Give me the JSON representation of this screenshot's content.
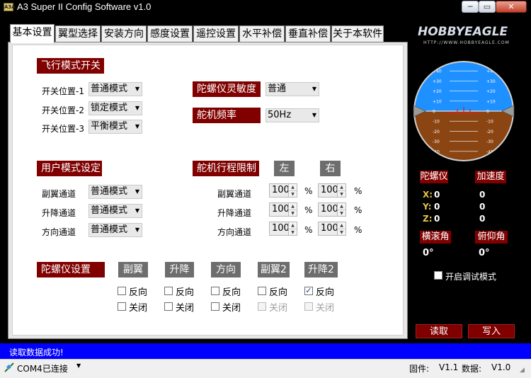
{
  "window": {
    "icon_text": "A3A",
    "title": "A3 Super II Config Software v1.0",
    "min_glyph": "─",
    "max_glyph": "▭",
    "close_glyph": "✕"
  },
  "tabs": [
    {
      "label": "基本设置",
      "active": true
    },
    {
      "label": "翼型选择"
    },
    {
      "label": "安装方向"
    },
    {
      "label": "感度设置"
    },
    {
      "label": "遥控设置"
    },
    {
      "label": "水平补偿"
    },
    {
      "label": "垂直补偿"
    },
    {
      "label": "关于本软件"
    }
  ],
  "flight_mode": {
    "title": "飞行模式开关",
    "rows": [
      {
        "label": "开关位置-1",
        "value": "普通模式"
      },
      {
        "label": "开关位置-2",
        "value": "锁定模式"
      },
      {
        "label": "开关位置-3",
        "value": "平衡模式"
      }
    ]
  },
  "gyro_sensitivity": {
    "title": "陀螺仪灵敏度",
    "value": "普通"
  },
  "servo_freq": {
    "title": "舵机频率",
    "value": "50Hz"
  },
  "user_mode": {
    "title": "用户模式设定",
    "rows": [
      {
        "label": "副翼通道",
        "value": "普通模式"
      },
      {
        "label": "升降通道",
        "value": "普通模式"
      },
      {
        "label": "方向通道",
        "value": "普通模式"
      }
    ]
  },
  "servo_travel": {
    "title": "舵机行程限制",
    "left_label": "左",
    "right_label": "右",
    "unit": "%",
    "rows": [
      {
        "label": "副翼通道",
        "left": "100",
        "right": "100"
      },
      {
        "label": "升降通道",
        "left": "100",
        "right": "100"
      },
      {
        "label": "方向通道",
        "left": "100",
        "right": "100"
      }
    ]
  },
  "gyro_settings": {
    "title": "陀螺仪设置",
    "reverse_label": "反向",
    "close_label": "关闭",
    "channels": [
      {
        "label": "副翼",
        "reverse": false,
        "close": false,
        "close_disabled": false
      },
      {
        "label": "升降",
        "reverse": false,
        "close": false,
        "close_disabled": false
      },
      {
        "label": "方向",
        "reverse": false,
        "close": false,
        "close_disabled": false
      },
      {
        "label": "副翼2",
        "reverse": false,
        "close": false,
        "close_disabled": true
      },
      {
        "label": "升降2",
        "reverse": true,
        "close": false,
        "close_disabled": true
      }
    ]
  },
  "brand": {
    "name": "HOBBYEAGLE",
    "url": "HTTP://WWW.HOBBYEAGLE.COM"
  },
  "attitude_indicator": {
    "pitch_labels": [
      "+40",
      "+30",
      "+20",
      "+10",
      "0",
      "-10",
      "-20",
      "-30",
      "-40"
    ],
    "sky_color": "#1e90ff",
    "ground_color": "#8b4513"
  },
  "sensors": {
    "gyro_title": "陀螺仪",
    "accel_title": "加速度",
    "axes": [
      {
        "axis": "X:",
        "gyro": "0",
        "accel": "0"
      },
      {
        "axis": "Y:",
        "gyro": "0",
        "accel": "0"
      },
      {
        "axis": "Z:",
        "gyro": "0",
        "accel": "0"
      }
    ],
    "roll_title": "横滚角",
    "pitch_title": "俯仰角",
    "roll_value": "0°",
    "pitch_value": "0°"
  },
  "debug_mode": {
    "label": "开启调试模式",
    "checked": false
  },
  "actions": {
    "read": "读取",
    "write": "写入"
  },
  "status": {
    "message": "读取数据成功!",
    "connection": "COM4已连接",
    "firmware_label": "固件:",
    "firmware_version": "V1.1",
    "data_label": "数据:",
    "data_version": "V1.0"
  },
  "colors": {
    "header_red": "#800000",
    "button_gray": "#6d6d6d",
    "status_blue": "#0000ff",
    "axis_yellow": "#e6c24c"
  }
}
